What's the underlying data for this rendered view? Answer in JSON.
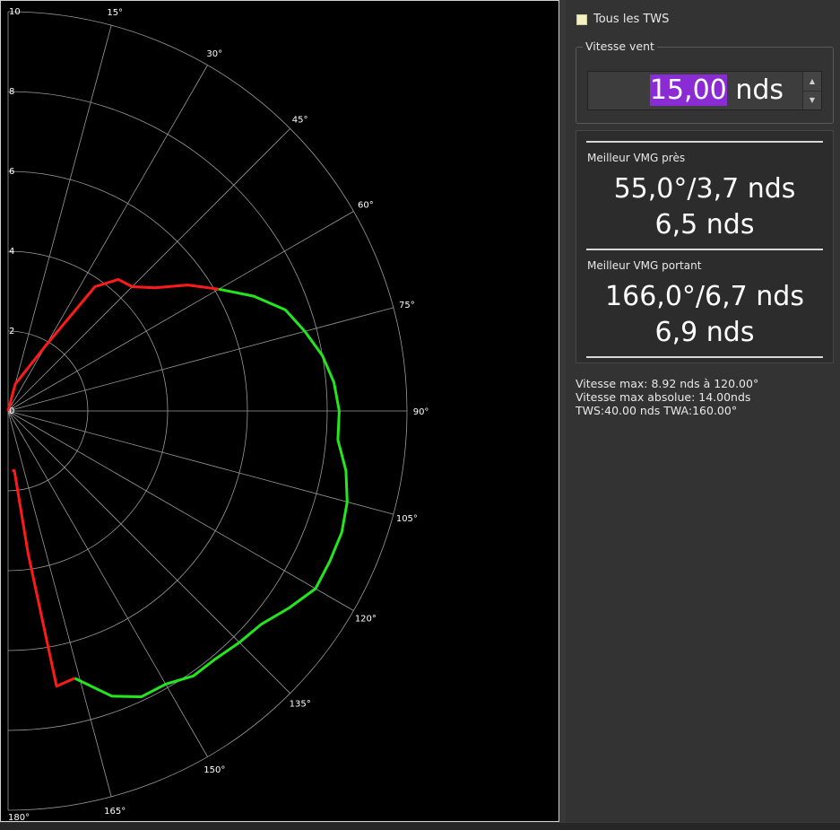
{
  "polar": {
    "radial_ticks": [
      "0",
      "2",
      "4",
      "6",
      "8",
      "10"
    ],
    "angle_ticks": [
      "15°",
      "30°",
      "45°",
      "60°",
      "75°",
      "90°",
      "105°",
      "120°",
      "135°",
      "150°",
      "165°",
      "180°"
    ],
    "colors": {
      "grid": "#9a9a9a",
      "background": "#000000",
      "red_curve": "#ff1a1a",
      "green_curve": "#22e61e"
    }
  },
  "chart_data": {
    "type": "line",
    "coordinate_system": "polar",
    "radial_range": [
      0,
      10
    ],
    "angle_range_deg": [
      0,
      180
    ],
    "grid": true,
    "series": [
      {
        "color": "#ff1a1a",
        "points": [
          {
            "angle": 0,
            "r": 0
          },
          {
            "angle": 15,
            "r": 0.7
          },
          {
            "angle": 30,
            "r": 1.9
          },
          {
            "angle": 35,
            "r": 3.8
          },
          {
            "angle": 40,
            "r": 4.3
          },
          {
            "angle": 45,
            "r": 4.4
          },
          {
            "angle": 50,
            "r": 4.8
          },
          {
            "angle": 55,
            "r": 5.5
          },
          {
            "angle": 60,
            "r": 6.1
          }
        ]
      },
      {
        "color": "#22e61e",
        "points": [
          {
            "angle": 60,
            "r": 6.1
          },
          {
            "angle": 65,
            "r": 6.8
          },
          {
            "angle": 70,
            "r": 7.4
          },
          {
            "angle": 75,
            "r": 7.7
          },
          {
            "angle": 80,
            "r": 8.0
          },
          {
            "angle": 85,
            "r": 8.2
          },
          {
            "angle": 90,
            "r": 8.3
          },
          {
            "angle": 95,
            "r": 8.3
          },
          {
            "angle": 100,
            "r": 8.6
          },
          {
            "angle": 105,
            "r": 8.8
          },
          {
            "angle": 110,
            "r": 8.9
          },
          {
            "angle": 115,
            "r": 8.9
          },
          {
            "angle": 120,
            "r": 8.9
          },
          {
            "angle": 125,
            "r": 8.6
          },
          {
            "angle": 130,
            "r": 8.3
          },
          {
            "angle": 135,
            "r": 8.2
          },
          {
            "angle": 140,
            "r": 8.1
          },
          {
            "angle": 145,
            "r": 8.1
          },
          {
            "angle": 150,
            "r": 7.9
          },
          {
            "angle": 155,
            "r": 7.9
          },
          {
            "angle": 160,
            "r": 7.6
          },
          {
            "angle": 166,
            "r": 6.9
          }
        ]
      },
      {
        "color": "#ff1a1a",
        "points": [
          {
            "angle": 166,
            "r": 6.9
          },
          {
            "angle": 170,
            "r": 7.0
          },
          {
            "angle": 172,
            "r": 3.6
          },
          {
            "angle": 174,
            "r": 1.5
          },
          {
            "angle": 176,
            "r": 1.5
          }
        ]
      }
    ]
  },
  "sidebar": {
    "all_tws_label": "Tous les TWS",
    "wind_group_title": "Vitesse vent",
    "wind_value": "15,00",
    "wind_unit": "nds",
    "upwind": {
      "title": "Meilleur VMG près",
      "line1": "55,0°/3,7 nds",
      "line2": "6,5 nds"
    },
    "downwind": {
      "title": "Meilleur VMG portant",
      "line1": "166,0°/6,7 nds",
      "line2": "6,9 nds"
    },
    "info": {
      "max_speed": "Vitesse max: 8.92 nds à 120.00°",
      "abs_max_speed": "Vitesse max absolue: 14.00nds",
      "tws_twa": "TWS:40.00 nds TWA:160.00°"
    },
    "colors": {
      "checkbox": "#f3f0c2",
      "selection": "#8a2bd4"
    },
    "icons": {
      "spin_up": "spin-up-arrow-icon",
      "spin_down": "spin-down-arrow-icon"
    }
  }
}
